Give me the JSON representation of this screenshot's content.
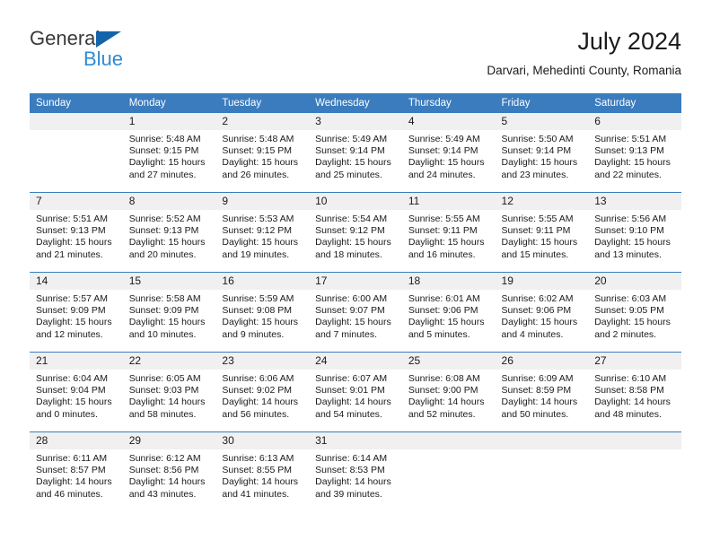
{
  "brand": {
    "name_part1": "General",
    "name_part2": "Blue",
    "triangle_color": "#1464aa",
    "blue_color": "#2e8bd6"
  },
  "header": {
    "title": "July 2024",
    "subtitle": "Darvari, Mehedinti County, Romania"
  },
  "theme": {
    "header_bg": "#3a7cbe",
    "daynum_bg": "#f0f0f0",
    "grid_line": "#3a7cbe"
  },
  "calendar": {
    "weekday_headers": [
      "Sunday",
      "Monday",
      "Tuesday",
      "Wednesday",
      "Thursday",
      "Friday",
      "Saturday"
    ],
    "weeks": [
      [
        {
          "day": "",
          "sunrise": "",
          "sunset": "",
          "daylight1": "",
          "daylight2": ""
        },
        {
          "day": "1",
          "sunrise": "Sunrise: 5:48 AM",
          "sunset": "Sunset: 9:15 PM",
          "daylight1": "Daylight: 15 hours",
          "daylight2": "and 27 minutes."
        },
        {
          "day": "2",
          "sunrise": "Sunrise: 5:48 AM",
          "sunset": "Sunset: 9:15 PM",
          "daylight1": "Daylight: 15 hours",
          "daylight2": "and 26 minutes."
        },
        {
          "day": "3",
          "sunrise": "Sunrise: 5:49 AM",
          "sunset": "Sunset: 9:14 PM",
          "daylight1": "Daylight: 15 hours",
          "daylight2": "and 25 minutes."
        },
        {
          "day": "4",
          "sunrise": "Sunrise: 5:49 AM",
          "sunset": "Sunset: 9:14 PM",
          "daylight1": "Daylight: 15 hours",
          "daylight2": "and 24 minutes."
        },
        {
          "day": "5",
          "sunrise": "Sunrise: 5:50 AM",
          "sunset": "Sunset: 9:14 PM",
          "daylight1": "Daylight: 15 hours",
          "daylight2": "and 23 minutes."
        },
        {
          "day": "6",
          "sunrise": "Sunrise: 5:51 AM",
          "sunset": "Sunset: 9:13 PM",
          "daylight1": "Daylight: 15 hours",
          "daylight2": "and 22 minutes."
        }
      ],
      [
        {
          "day": "7",
          "sunrise": "Sunrise: 5:51 AM",
          "sunset": "Sunset: 9:13 PM",
          "daylight1": "Daylight: 15 hours",
          "daylight2": "and 21 minutes."
        },
        {
          "day": "8",
          "sunrise": "Sunrise: 5:52 AM",
          "sunset": "Sunset: 9:13 PM",
          "daylight1": "Daylight: 15 hours",
          "daylight2": "and 20 minutes."
        },
        {
          "day": "9",
          "sunrise": "Sunrise: 5:53 AM",
          "sunset": "Sunset: 9:12 PM",
          "daylight1": "Daylight: 15 hours",
          "daylight2": "and 19 minutes."
        },
        {
          "day": "10",
          "sunrise": "Sunrise: 5:54 AM",
          "sunset": "Sunset: 9:12 PM",
          "daylight1": "Daylight: 15 hours",
          "daylight2": "and 18 minutes."
        },
        {
          "day": "11",
          "sunrise": "Sunrise: 5:55 AM",
          "sunset": "Sunset: 9:11 PM",
          "daylight1": "Daylight: 15 hours",
          "daylight2": "and 16 minutes."
        },
        {
          "day": "12",
          "sunrise": "Sunrise: 5:55 AM",
          "sunset": "Sunset: 9:11 PM",
          "daylight1": "Daylight: 15 hours",
          "daylight2": "and 15 minutes."
        },
        {
          "day": "13",
          "sunrise": "Sunrise: 5:56 AM",
          "sunset": "Sunset: 9:10 PM",
          "daylight1": "Daylight: 15 hours",
          "daylight2": "and 13 minutes."
        }
      ],
      [
        {
          "day": "14",
          "sunrise": "Sunrise: 5:57 AM",
          "sunset": "Sunset: 9:09 PM",
          "daylight1": "Daylight: 15 hours",
          "daylight2": "and 12 minutes."
        },
        {
          "day": "15",
          "sunrise": "Sunrise: 5:58 AM",
          "sunset": "Sunset: 9:09 PM",
          "daylight1": "Daylight: 15 hours",
          "daylight2": "and 10 minutes."
        },
        {
          "day": "16",
          "sunrise": "Sunrise: 5:59 AM",
          "sunset": "Sunset: 9:08 PM",
          "daylight1": "Daylight: 15 hours",
          "daylight2": "and 9 minutes."
        },
        {
          "day": "17",
          "sunrise": "Sunrise: 6:00 AM",
          "sunset": "Sunset: 9:07 PM",
          "daylight1": "Daylight: 15 hours",
          "daylight2": "and 7 minutes."
        },
        {
          "day": "18",
          "sunrise": "Sunrise: 6:01 AM",
          "sunset": "Sunset: 9:06 PM",
          "daylight1": "Daylight: 15 hours",
          "daylight2": "and 5 minutes."
        },
        {
          "day": "19",
          "sunrise": "Sunrise: 6:02 AM",
          "sunset": "Sunset: 9:06 PM",
          "daylight1": "Daylight: 15 hours",
          "daylight2": "and 4 minutes."
        },
        {
          "day": "20",
          "sunrise": "Sunrise: 6:03 AM",
          "sunset": "Sunset: 9:05 PM",
          "daylight1": "Daylight: 15 hours",
          "daylight2": "and 2 minutes."
        }
      ],
      [
        {
          "day": "21",
          "sunrise": "Sunrise: 6:04 AM",
          "sunset": "Sunset: 9:04 PM",
          "daylight1": "Daylight: 15 hours",
          "daylight2": "and 0 minutes."
        },
        {
          "day": "22",
          "sunrise": "Sunrise: 6:05 AM",
          "sunset": "Sunset: 9:03 PM",
          "daylight1": "Daylight: 14 hours",
          "daylight2": "and 58 minutes."
        },
        {
          "day": "23",
          "sunrise": "Sunrise: 6:06 AM",
          "sunset": "Sunset: 9:02 PM",
          "daylight1": "Daylight: 14 hours",
          "daylight2": "and 56 minutes."
        },
        {
          "day": "24",
          "sunrise": "Sunrise: 6:07 AM",
          "sunset": "Sunset: 9:01 PM",
          "daylight1": "Daylight: 14 hours",
          "daylight2": "and 54 minutes."
        },
        {
          "day": "25",
          "sunrise": "Sunrise: 6:08 AM",
          "sunset": "Sunset: 9:00 PM",
          "daylight1": "Daylight: 14 hours",
          "daylight2": "and 52 minutes."
        },
        {
          "day": "26",
          "sunrise": "Sunrise: 6:09 AM",
          "sunset": "Sunset: 8:59 PM",
          "daylight1": "Daylight: 14 hours",
          "daylight2": "and 50 minutes."
        },
        {
          "day": "27",
          "sunrise": "Sunrise: 6:10 AM",
          "sunset": "Sunset: 8:58 PM",
          "daylight1": "Daylight: 14 hours",
          "daylight2": "and 48 minutes."
        }
      ],
      [
        {
          "day": "28",
          "sunrise": "Sunrise: 6:11 AM",
          "sunset": "Sunset: 8:57 PM",
          "daylight1": "Daylight: 14 hours",
          "daylight2": "and 46 minutes."
        },
        {
          "day": "29",
          "sunrise": "Sunrise: 6:12 AM",
          "sunset": "Sunset: 8:56 PM",
          "daylight1": "Daylight: 14 hours",
          "daylight2": "and 43 minutes."
        },
        {
          "day": "30",
          "sunrise": "Sunrise: 6:13 AM",
          "sunset": "Sunset: 8:55 PM",
          "daylight1": "Daylight: 14 hours",
          "daylight2": "and 41 minutes."
        },
        {
          "day": "31",
          "sunrise": "Sunrise: 6:14 AM",
          "sunset": "Sunset: 8:53 PM",
          "daylight1": "Daylight: 14 hours",
          "daylight2": "and 39 minutes."
        },
        {
          "day": "",
          "sunrise": "",
          "sunset": "",
          "daylight1": "",
          "daylight2": ""
        },
        {
          "day": "",
          "sunrise": "",
          "sunset": "",
          "daylight1": "",
          "daylight2": ""
        },
        {
          "day": "",
          "sunrise": "",
          "sunset": "",
          "daylight1": "",
          "daylight2": ""
        }
      ]
    ]
  }
}
